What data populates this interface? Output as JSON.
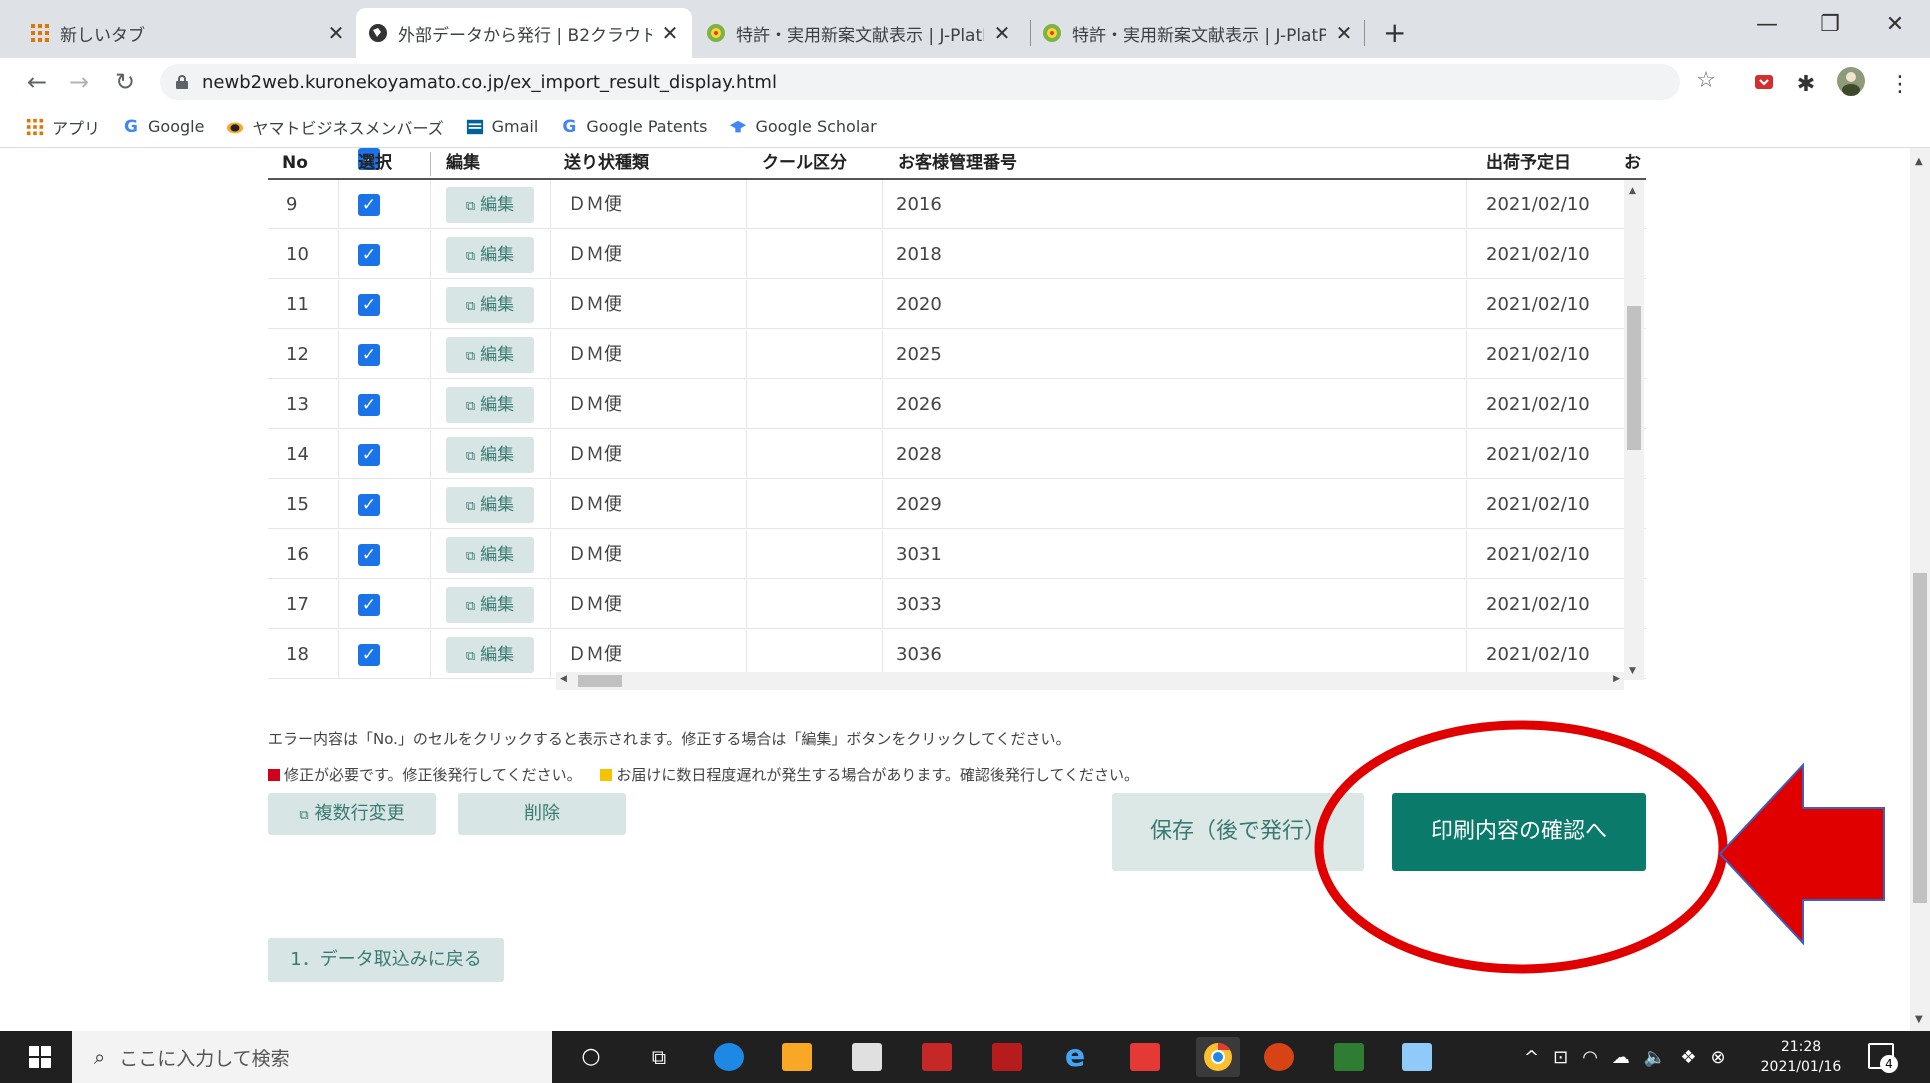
{
  "browser": {
    "tabs": [
      {
        "title": "新しいタブ",
        "active": false
      },
      {
        "title": "外部データから発行 | B2クラウド",
        "active": true
      },
      {
        "title": "特許・実用新案文献表示 | J-PlatP",
        "active": false
      },
      {
        "title": "特許・実用新案文献表示 | J-PlatP",
        "active": false
      }
    ],
    "url": "newb2web.kuronekoyamato.co.jp/ex_import_result_display.html",
    "bookmarks": [
      "アプリ",
      "Google",
      "ヤマトビジネスメンバーズ",
      "Gmail",
      "Google Patents",
      "Google Scholar"
    ]
  },
  "table": {
    "headers": [
      "No",
      "選択",
      "編集",
      "送り状種類",
      "クール区分",
      "お客様管理番号",
      "出荷予定日",
      "お"
    ],
    "edit_label": "編集",
    "rows": [
      {
        "no": "9",
        "type": "ＤＭ便",
        "cool": "",
        "mgmt": "2016",
        "date": "2021/02/10"
      },
      {
        "no": "10",
        "type": "ＤＭ便",
        "cool": "",
        "mgmt": "2018",
        "date": "2021/02/10"
      },
      {
        "no": "11",
        "type": "ＤＭ便",
        "cool": "",
        "mgmt": "2020",
        "date": "2021/02/10"
      },
      {
        "no": "12",
        "type": "ＤＭ便",
        "cool": "",
        "mgmt": "2025",
        "date": "2021/02/10"
      },
      {
        "no": "13",
        "type": "ＤＭ便",
        "cool": "",
        "mgmt": "2026",
        "date": "2021/02/10"
      },
      {
        "no": "14",
        "type": "ＤＭ便",
        "cool": "",
        "mgmt": "2028",
        "date": "2021/02/10"
      },
      {
        "no": "15",
        "type": "ＤＭ便",
        "cool": "",
        "mgmt": "2029",
        "date": "2021/02/10"
      },
      {
        "no": "16",
        "type": "ＤＭ便",
        "cool": "",
        "mgmt": "3031",
        "date": "2021/02/10"
      },
      {
        "no": "17",
        "type": "ＤＭ便",
        "cool": "",
        "mgmt": "3033",
        "date": "2021/02/10"
      },
      {
        "no": "18",
        "type": "ＤＭ便",
        "cool": "",
        "mgmt": "3036",
        "date": "2021/02/10"
      }
    ]
  },
  "notes": {
    "line1": "エラー内容は「No.」のセルをクリックすると表示されます。修正する場合は「編集」ボタンをクリックしてください。",
    "red_text": "修正が必要です。修正後発行してください。",
    "yellow_text": "お届けに数日程度遅れが発生する場合があります。確認後発行してください。"
  },
  "buttons": {
    "multi_edit": "複数行変更",
    "delete": "削除",
    "save": "保存（後で発行）",
    "confirm": "印刷内容の確認へ",
    "back": "1．データ取込みに戻る"
  },
  "taskbar": {
    "search_placeholder": "ここに入力して検索",
    "time": "21:28",
    "date": "2021/01/16",
    "notification_count": "4"
  },
  "colors": {
    "accent": "#0a7a6a",
    "button_bg": "#d7e6e4",
    "checkbox": "#1a73e8",
    "annotation_red": "#e00000",
    "error_marker": "#d0021b",
    "warning_marker": "#f5c400"
  }
}
